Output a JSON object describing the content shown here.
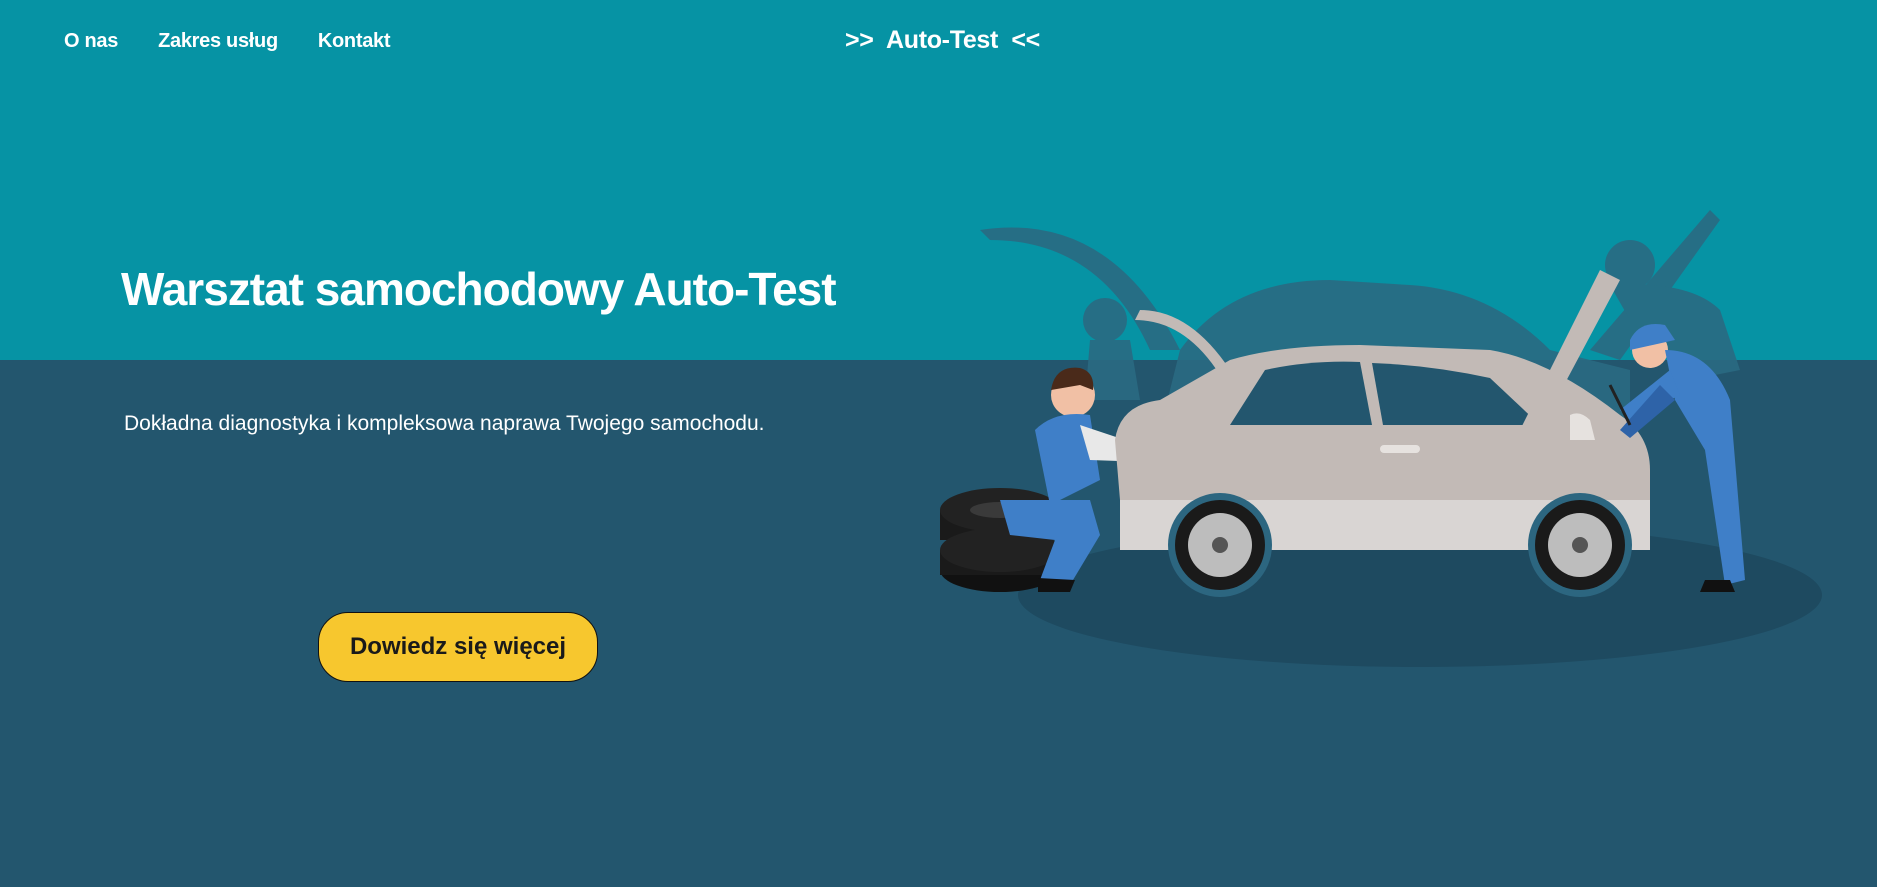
{
  "nav": {
    "items": [
      {
        "label": "O nas"
      },
      {
        "label": "Zakres usług"
      },
      {
        "label": "Kontakt"
      }
    ]
  },
  "brand": {
    "text": ">>  Auto-Test  <<"
  },
  "hero": {
    "title": "Warsztat samochodowy Auto-Test",
    "subtitle": "Dokładna diagnostyka i kompleksowa naprawa Twojego samochodu.",
    "cta_label": "Dowiedz się więcej"
  },
  "colors": {
    "top_background": "#0693a4",
    "bottom_background": "#23566e",
    "button": "#f7c72e",
    "text": "#ffffff"
  },
  "illustration": {
    "icon": "car-repair-illustration"
  }
}
